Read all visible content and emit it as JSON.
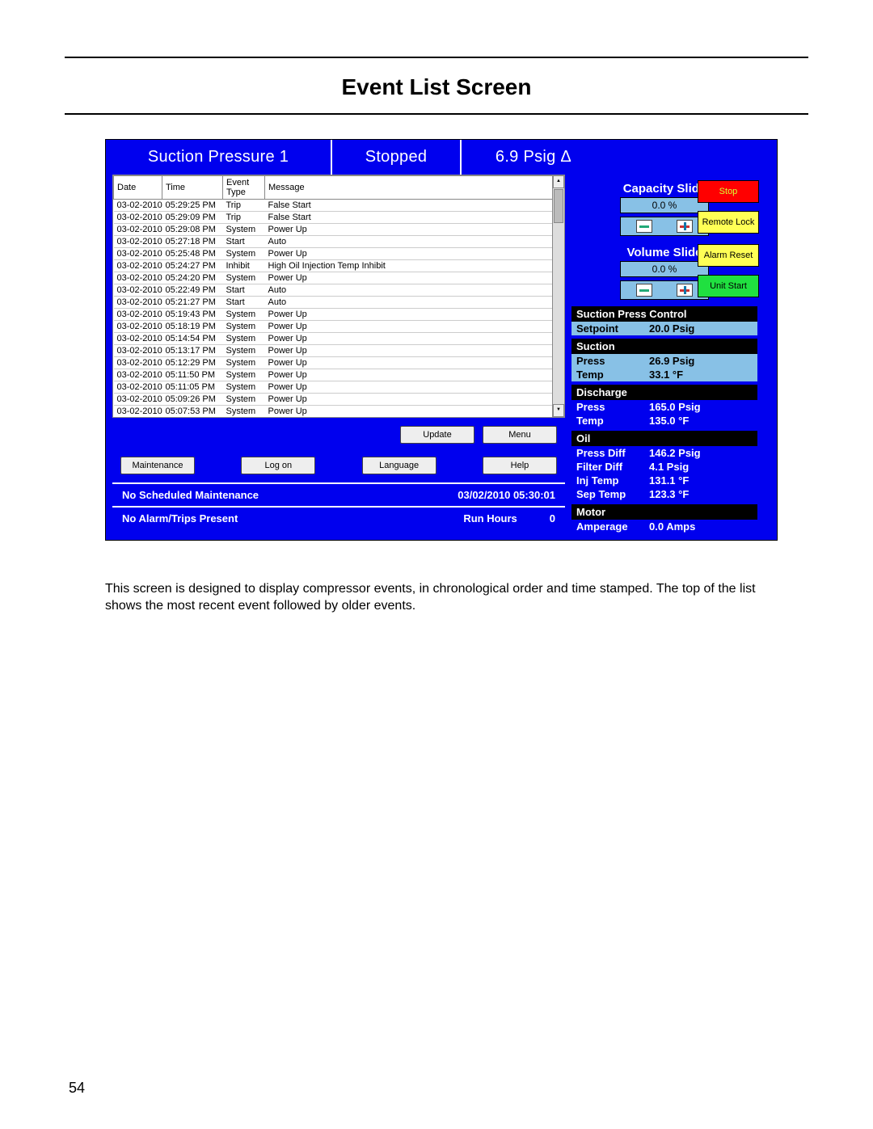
{
  "doc": {
    "title": "Event List Screen",
    "body_text": "This screen is designed to display compressor events, in chronological order and time stamped.  The top of the list shows the most recent event followed by older events.",
    "page_number": "54"
  },
  "header": {
    "suction_label": "Suction Pressure 1",
    "status": "Stopped",
    "pressure": "6.9 Psig Δ"
  },
  "event_table": {
    "cols": {
      "date": "Date",
      "time": "Time",
      "type": "Event Type",
      "msg": "Message"
    },
    "rows": [
      {
        "d": "03-02-2010",
        "t": "05:29:25 PM",
        "y": "Trip",
        "m": "False Start"
      },
      {
        "d": "03-02-2010",
        "t": "05:29:09 PM",
        "y": "Trip",
        "m": "False Start"
      },
      {
        "d": "03-02-2010",
        "t": "05:29:08 PM",
        "y": "System",
        "m": "Power Up"
      },
      {
        "d": "03-02-2010",
        "t": "05:27:18 PM",
        "y": "Start",
        "m": "Auto"
      },
      {
        "d": "03-02-2010",
        "t": "05:25:48 PM",
        "y": "System",
        "m": "Power Up"
      },
      {
        "d": "03-02-2010",
        "t": "05:24:27 PM",
        "y": "Inhibit",
        "m": "High Oil Injection Temp Inhibit"
      },
      {
        "d": "03-02-2010",
        "t": "05:24:20 PM",
        "y": "System",
        "m": "Power Up"
      },
      {
        "d": "03-02-2010",
        "t": "05:22:49 PM",
        "y": "Start",
        "m": "Auto"
      },
      {
        "d": "03-02-2010",
        "t": "05:21:27 PM",
        "y": "Start",
        "m": "Auto"
      },
      {
        "d": "03-02-2010",
        "t": "05:19:43 PM",
        "y": "System",
        "m": "Power Up"
      },
      {
        "d": "03-02-2010",
        "t": "05:18:19 PM",
        "y": "System",
        "m": "Power Up"
      },
      {
        "d": "03-02-2010",
        "t": "05:14:54 PM",
        "y": "System",
        "m": "Power Up"
      },
      {
        "d": "03-02-2010",
        "t": "05:13:17 PM",
        "y": "System",
        "m": "Power Up"
      },
      {
        "d": "03-02-2010",
        "t": "05:12:29 PM",
        "y": "System",
        "m": "Power Up"
      },
      {
        "d": "03-02-2010",
        "t": "05:11:50 PM",
        "y": "System",
        "m": "Power Up"
      },
      {
        "d": "03-02-2010",
        "t": "05:11:05 PM",
        "y": "System",
        "m": "Power Up"
      },
      {
        "d": "03-02-2010",
        "t": "05:09:26 PM",
        "y": "System",
        "m": "Power Up"
      },
      {
        "d": "03-02-2010",
        "t": "05:07:53 PM",
        "y": "System",
        "m": "Power Up"
      }
    ]
  },
  "buttons": {
    "update": "Update",
    "menu": "Menu",
    "maintenance": "Maintenance",
    "logon": "Log on",
    "language": "Language",
    "help": "Help"
  },
  "status_bar": {
    "maint_text": "No Scheduled Maintenance",
    "datetime": "03/02/2010  05:30:01",
    "alarm_text": "No Alarm/Trips Present",
    "run_hours_label": "Run Hours",
    "run_hours_val": "0"
  },
  "right": {
    "capacity_title": "Capacity Slide",
    "capacity_val": "0.0 %",
    "volume_title": "Volume Slide",
    "volume_val": "0.0 %",
    "side_buttons": {
      "stop": "Stop",
      "remote": "Remote Lock",
      "alarm": "Alarm Reset",
      "unit": "Unit Start"
    },
    "spc_title": "Suction Press Control",
    "spc_setpoint_k": "Setpoint",
    "spc_setpoint_v": "20.0 Psig",
    "suction_title": "Suction",
    "suction_press_k": "Press",
    "suction_press_v": "26.9 Psig",
    "suction_temp_k": "Temp",
    "suction_temp_v": "33.1 °F",
    "discharge_title": "Discharge",
    "discharge_press_k": "Press",
    "discharge_press_v": "165.0 Psig",
    "discharge_temp_k": "Temp",
    "discharge_temp_v": "135.0 °F",
    "oil_title": "Oil",
    "oil_pressdiff_k": "Press Diff",
    "oil_pressdiff_v": "146.2 Psig",
    "oil_filterdiff_k": "Filter Diff",
    "oil_filterdiff_v": "4.1 Psig",
    "oil_injtemp_k": "Inj Temp",
    "oil_injtemp_v": "131.1 °F",
    "oil_septemp_k": "Sep Temp",
    "oil_septemp_v": "123.3 °F",
    "motor_title": "Motor",
    "motor_amp_k": "Amperage",
    "motor_amp_v": "0.0 Amps"
  }
}
